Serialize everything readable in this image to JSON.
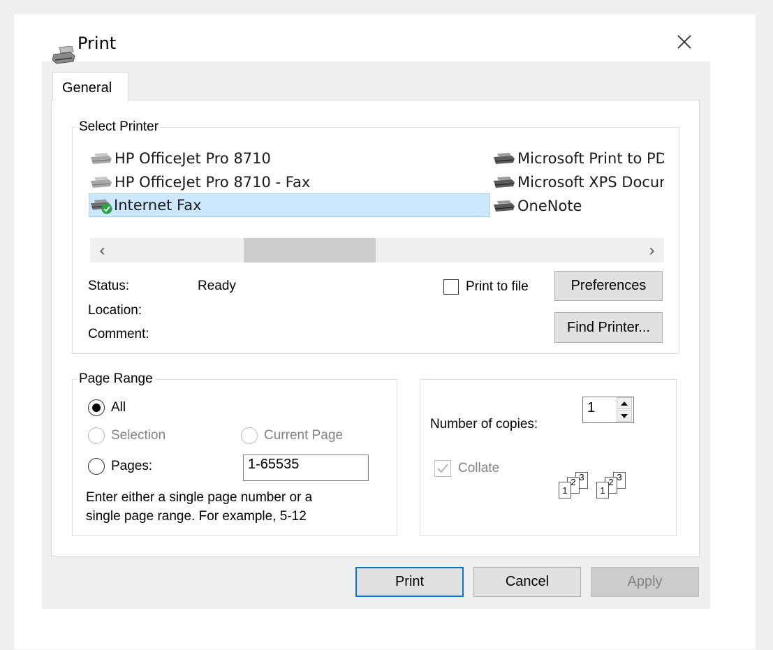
{
  "window": {
    "title": "Print"
  },
  "tabs": [
    {
      "label": "General"
    }
  ],
  "select_printer": {
    "legend": "Select Printer",
    "printers": [
      {
        "name": "HP OfficeJet Pro 8710"
      },
      {
        "name": "HP OfficeJet Pro 8710 - Fax"
      },
      {
        "name": "Internet Fax",
        "selected": true
      },
      {
        "name": "Microsoft Print to PDF"
      },
      {
        "name": "Microsoft XPS Document Writer"
      },
      {
        "name": "OneNote"
      }
    ],
    "scroll": {
      "left_arrow": "‹",
      "right_arrow": "›"
    },
    "status_label": "Status:",
    "status_value": "Ready",
    "location_label": "Location:",
    "comment_label": "Comment:",
    "print_to_file_label": "Print to file",
    "preferences_label": "Preferences",
    "find_printer_label": "Find Printer..."
  },
  "page_range": {
    "legend": "Page Range",
    "all_label": "All",
    "selection_label": "Selection",
    "current_page_label": "Current Page",
    "pages_label": "Pages:",
    "pages_value": "1-65535",
    "hint_line1": "Enter either a single page number or a",
    "hint_line2": "single page range.  For example, 5-12"
  },
  "copies": {
    "label": "Number of copies:",
    "value": "1",
    "collate_label": "Collate",
    "collate_sets": [
      {
        "pages": [
          "1",
          "2",
          "3"
        ]
      },
      {
        "pages": [
          "1",
          "2",
          "3"
        ]
      }
    ]
  },
  "footer": {
    "print_label": "Print",
    "cancel_label": "Cancel",
    "apply_label": "Apply"
  },
  "colors": {
    "selection_bg": "#cce8ff",
    "selection_border": "#99d1ff",
    "button_bg": "#e1e1e1",
    "default_button_border": "#0078d7",
    "status_ok_green": "#2da546",
    "disabled_text": "#838383"
  }
}
